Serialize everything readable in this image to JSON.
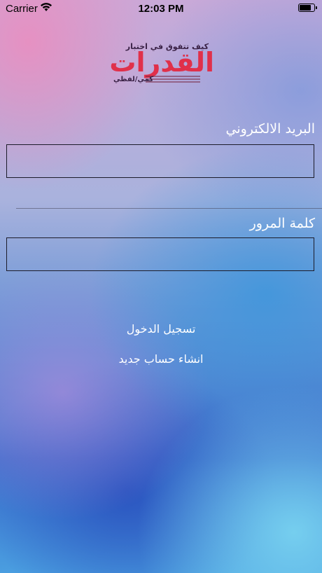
{
  "status_bar": {
    "carrier": "Carrier",
    "time": "12:03 PM",
    "battery_level": 0.95
  },
  "logo": {
    "top_text": "كيف تتفوق في اختبار",
    "main_text": "القدرات",
    "sub_text": "كمي/لفظي",
    "accent_color": "#e0304a"
  },
  "form": {
    "email_label": "البريد الالكتروني",
    "email_value": "",
    "password_label": "كلمة المرور",
    "password_value": ""
  },
  "actions": {
    "login_label": "تسجيل الدخول",
    "register_label": "انشاء حساب جديد"
  }
}
